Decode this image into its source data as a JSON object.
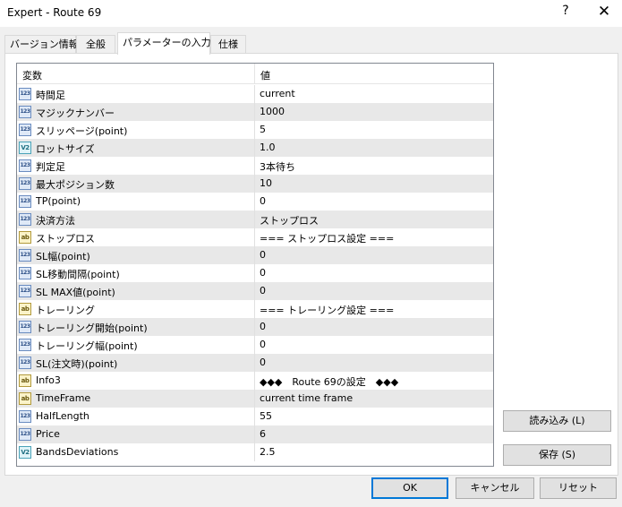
{
  "window": {
    "title": "Expert - Route 69",
    "help_glyph": "?",
    "close_glyph": "✕"
  },
  "tabs": [
    {
      "label": "バージョン情報"
    },
    {
      "label": "全般"
    },
    {
      "label": "パラメーターの入力",
      "active": true
    },
    {
      "label": "仕様"
    }
  ],
  "grid": {
    "col_variable": "変数",
    "col_value": "値",
    "rows": [
      {
        "icon": "123",
        "name": "時間足",
        "value": "current"
      },
      {
        "icon": "123",
        "name": "マジックナンバー",
        "value": "1000"
      },
      {
        "icon": "123",
        "name": "スリッページ(point)",
        "value": "5"
      },
      {
        "icon": "V2",
        "name": "ロットサイズ",
        "value": "1.0"
      },
      {
        "icon": "123",
        "name": "判定足",
        "value": "3本待ち"
      },
      {
        "icon": "123",
        "name": "最大ポジション数",
        "value": "10"
      },
      {
        "icon": "123",
        "name": "TP(point)",
        "value": "0"
      },
      {
        "icon": "123",
        "name": "決済方法",
        "value": "ストップロス"
      },
      {
        "icon": "ab",
        "name": "ストップロス",
        "value": " === ストップロス設定 ==="
      },
      {
        "icon": "123",
        "name": "SL幅(point)",
        "value": "0"
      },
      {
        "icon": "123",
        "name": "SL移動間隔(point)",
        "value": "0"
      },
      {
        "icon": "123",
        "name": "SL MAX値(point)",
        "value": "0"
      },
      {
        "icon": "ab",
        "name": "トレーリング",
        "value": " === トレーリング設定 ==="
      },
      {
        "icon": "123",
        "name": "トレーリング開始(point)",
        "value": "0"
      },
      {
        "icon": "123",
        "name": "トレーリング幅(point)",
        "value": "0"
      },
      {
        "icon": "123",
        "name": "SL(注文時)(point)",
        "value": "0"
      },
      {
        "icon": "ab",
        "name": "Info3",
        "value": "◆◆◆　Route 69の設定　◆◆◆"
      },
      {
        "icon": "ab",
        "name": "TimeFrame",
        "value": "current time frame"
      },
      {
        "icon": "123",
        "name": "HalfLength",
        "value": "55"
      },
      {
        "icon": "123",
        "name": "Price",
        "value": "6"
      },
      {
        "icon": "V2",
        "name": "BandsDeviations",
        "value": "2.5"
      }
    ]
  },
  "side_buttons": {
    "load": "読み込み (L)",
    "save": "保存 (S)"
  },
  "footer_buttons": {
    "ok": "OK",
    "cancel": "キャンセル",
    "reset": "リセット"
  },
  "colors": {
    "accent": "#0078d7",
    "row_alt": "#e8e8e8"
  }
}
